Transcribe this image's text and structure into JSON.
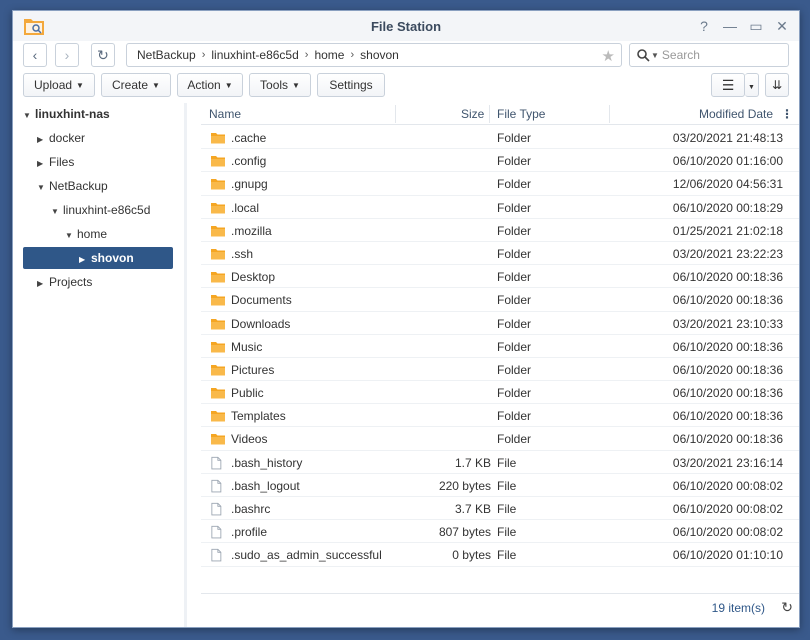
{
  "window": {
    "title": "File Station"
  },
  "nav": {
    "breadcrumb": [
      "NetBackup",
      "linuxhint-e86c5d",
      "home",
      "shovon"
    ],
    "search_placeholder": "Search"
  },
  "toolbar": {
    "upload": "Upload",
    "create": "Create",
    "action": "Action",
    "tools": "Tools",
    "settings": "Settings"
  },
  "sidebar": {
    "items": [
      {
        "label": "linuxhint-nas",
        "level": 0,
        "expanded": true,
        "root": true
      },
      {
        "label": "docker",
        "level": 1,
        "expanded": false
      },
      {
        "label": "Files",
        "level": 1,
        "expanded": false
      },
      {
        "label": "NetBackup",
        "level": 1,
        "expanded": true
      },
      {
        "label": "linuxhint-e86c5d",
        "level": 2,
        "expanded": true
      },
      {
        "label": "home",
        "level": 3,
        "expanded": true
      },
      {
        "label": "shovon",
        "level": 4,
        "expanded": false,
        "selected": true
      },
      {
        "label": "Projects",
        "level": 1,
        "expanded": false
      }
    ]
  },
  "table": {
    "columns": {
      "name": "Name",
      "size": "Size",
      "type": "File Type",
      "modified": "Modified Date"
    },
    "rows": [
      {
        "name": ".cache",
        "size": "",
        "type": "Folder",
        "modified": "03/20/2021 21:48:13",
        "kind": "folder"
      },
      {
        "name": ".config",
        "size": "",
        "type": "Folder",
        "modified": "06/10/2020 01:16:00",
        "kind": "folder"
      },
      {
        "name": ".gnupg",
        "size": "",
        "type": "Folder",
        "modified": "12/06/2020 04:56:31",
        "kind": "folder"
      },
      {
        "name": ".local",
        "size": "",
        "type": "Folder",
        "modified": "06/10/2020 00:18:29",
        "kind": "folder"
      },
      {
        "name": ".mozilla",
        "size": "",
        "type": "Folder",
        "modified": "01/25/2021 21:02:18",
        "kind": "folder"
      },
      {
        "name": ".ssh",
        "size": "",
        "type": "Folder",
        "modified": "03/20/2021 23:22:23",
        "kind": "folder"
      },
      {
        "name": "Desktop",
        "size": "",
        "type": "Folder",
        "modified": "06/10/2020 00:18:36",
        "kind": "folder"
      },
      {
        "name": "Documents",
        "size": "",
        "type": "Folder",
        "modified": "06/10/2020 00:18:36",
        "kind": "folder"
      },
      {
        "name": "Downloads",
        "size": "",
        "type": "Folder",
        "modified": "03/20/2021 23:10:33",
        "kind": "folder"
      },
      {
        "name": "Music",
        "size": "",
        "type": "Folder",
        "modified": "06/10/2020 00:18:36",
        "kind": "folder"
      },
      {
        "name": "Pictures",
        "size": "",
        "type": "Folder",
        "modified": "06/10/2020 00:18:36",
        "kind": "folder"
      },
      {
        "name": "Public",
        "size": "",
        "type": "Folder",
        "modified": "06/10/2020 00:18:36",
        "kind": "folder"
      },
      {
        "name": "Templates",
        "size": "",
        "type": "Folder",
        "modified": "06/10/2020 00:18:36",
        "kind": "folder"
      },
      {
        "name": "Videos",
        "size": "",
        "type": "Folder",
        "modified": "06/10/2020 00:18:36",
        "kind": "folder"
      },
      {
        "name": ".bash_history",
        "size": "1.7 KB",
        "type": "File",
        "modified": "03/20/2021 23:16:14",
        "kind": "file"
      },
      {
        "name": ".bash_logout",
        "size": "220 bytes",
        "type": "File",
        "modified": "06/10/2020 00:08:02",
        "kind": "file"
      },
      {
        "name": ".bashrc",
        "size": "3.7 KB",
        "type": "File",
        "modified": "06/10/2020 00:08:02",
        "kind": "file"
      },
      {
        "name": ".profile",
        "size": "807 bytes",
        "type": "File",
        "modified": "06/10/2020 00:08:02",
        "kind": "file"
      },
      {
        "name": ".sudo_as_admin_successful",
        "size": "0 bytes",
        "type": "File",
        "modified": "06/10/2020 01:10:10",
        "kind": "file"
      }
    ],
    "footer_count": "19 item(s)"
  },
  "colors": {
    "accent": "#2f5788",
    "folder": "#f5a623"
  }
}
